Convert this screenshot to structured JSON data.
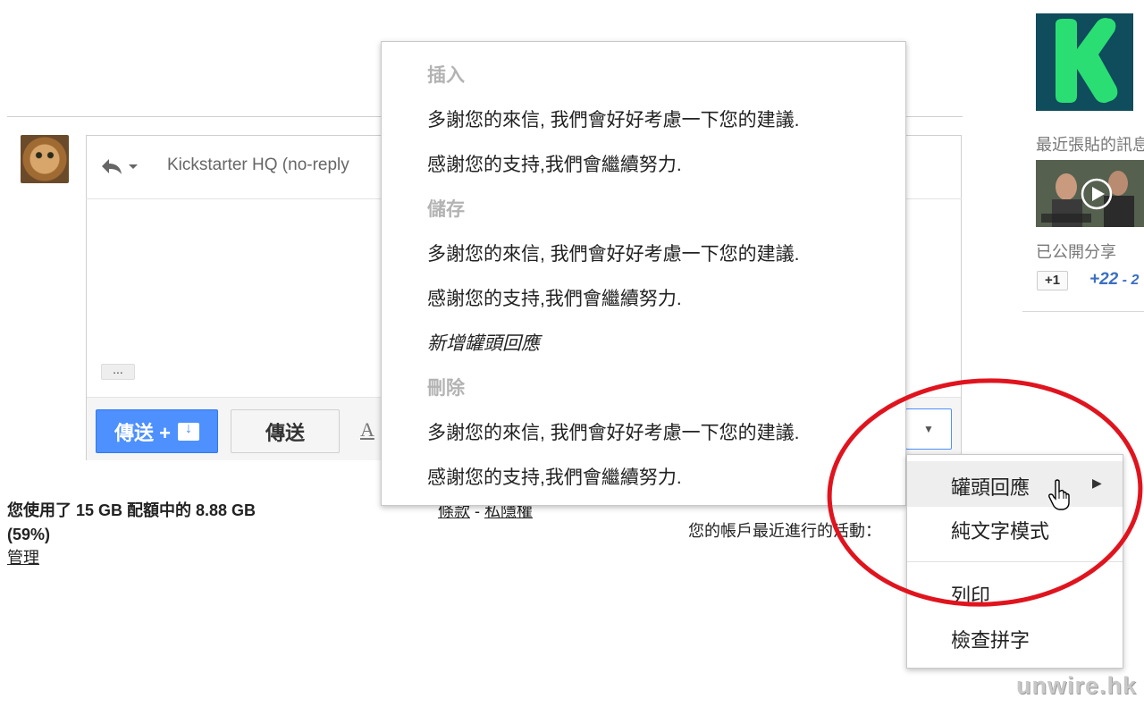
{
  "compose": {
    "recipient": "Kickstarter HQ (no-reply",
    "ellipsis": "...",
    "send_archive_label": "傳送 +",
    "send_label": "傳送",
    "format_label": "A"
  },
  "footer": {
    "quota": "您使用了 15 GB 配額中的 8.88 GB",
    "quota_percent": "(59%)",
    "manage": "管理",
    "terms": "條款",
    "terms_sep": " - ",
    "privacy": "私隱權",
    "activity": "您的帳戶最近進行的活動："
  },
  "canned_menu": {
    "insert_header": "插入",
    "insert_items": [
      "多謝您的來信, 我們會好好考慮一下您的建議.",
      "感謝您的支持,我們會繼續努力."
    ],
    "save_header": "儲存",
    "save_items": [
      "多謝您的來信, 我們會好好考慮一下您的建議.",
      "感謝您的支持,我們會繼續努力."
    ],
    "new_response": "新增罐頭回應",
    "delete_header": "刪除",
    "delete_items": [
      "多謝您的來信, 我們會好好考慮一下您的建議.",
      "感謝您的支持,我們會繼續努力."
    ]
  },
  "more_menu": {
    "canned_responses": "罐頭回應",
    "plain_text": "純文字模式",
    "print": "列印",
    "spell_check": "檢查拼字"
  },
  "sidebar": {
    "recent_posts": "最近張貼的訊息",
    "shared_publicly": "已公開分享",
    "plus_one": "+1",
    "plus_count": "+22",
    "plus_count_suffix": " - 2"
  },
  "watermark": "unwire.hk",
  "colors": {
    "primary_button": "#4d90fe",
    "highlight_oval": "#e0141e",
    "kickstarter_green": "#2bde73"
  }
}
